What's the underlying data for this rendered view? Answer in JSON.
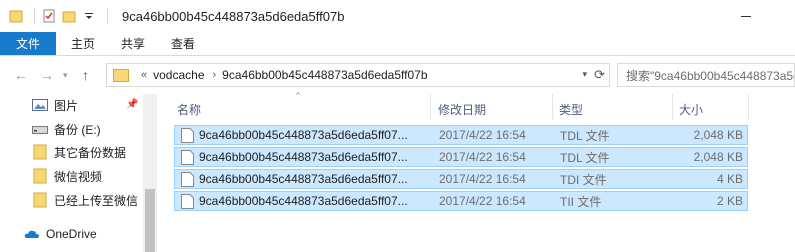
{
  "window": {
    "title": "9ca46bb00b45c448873a5d6eda5ff07b"
  },
  "ribbon": {
    "tabs": [
      "文件",
      "主页",
      "共享",
      "查看"
    ]
  },
  "address": {
    "overflow": "«",
    "crumbs": [
      "vodcache",
      "9ca46bb00b45c448873a5d6eda5ff07b"
    ],
    "separator": "›"
  },
  "search": {
    "placeholder": "搜索\"9ca46bb00b45c448873a5d6"
  },
  "sidebar": {
    "items": [
      {
        "label": "图片",
        "icon": "pictures-icon"
      },
      {
        "label": "备份 (E:)",
        "icon": "drive-icon"
      },
      {
        "label": "其它备份数据",
        "icon": "folder-icon"
      },
      {
        "label": "微信视频",
        "icon": "folder-icon"
      },
      {
        "label": "已经上传至微信",
        "icon": "folder-icon"
      },
      {
        "label": "OneDrive",
        "icon": "onedrive-icon"
      }
    ]
  },
  "columns": {
    "name": "名称",
    "date": "修改日期",
    "type": "类型",
    "size": "大小"
  },
  "files": [
    {
      "name": "9ca46bb00b45c448873a5d6eda5ff07...",
      "date": "2017/4/22 16:54",
      "type": "TDL 文件",
      "size": "2,048 KB"
    },
    {
      "name": "9ca46bb00b45c448873a5d6eda5ff07...",
      "date": "2017/4/22 16:54",
      "type": "TDL 文件",
      "size": "2,048 KB"
    },
    {
      "name": "9ca46bb00b45c448873a5d6eda5ff07...",
      "date": "2017/4/22 16:54",
      "type": "TDI 文件",
      "size": "4 KB"
    },
    {
      "name": "9ca46bb00b45c448873a5d6eda5ff07...",
      "date": "2017/4/22 16:54",
      "type": "TII 文件",
      "size": "2 KB"
    }
  ],
  "colors": {
    "accent": "#1979ca",
    "selection": "#cce8ff",
    "selection_border": "#99d1ff",
    "folder": "#f8d775"
  }
}
